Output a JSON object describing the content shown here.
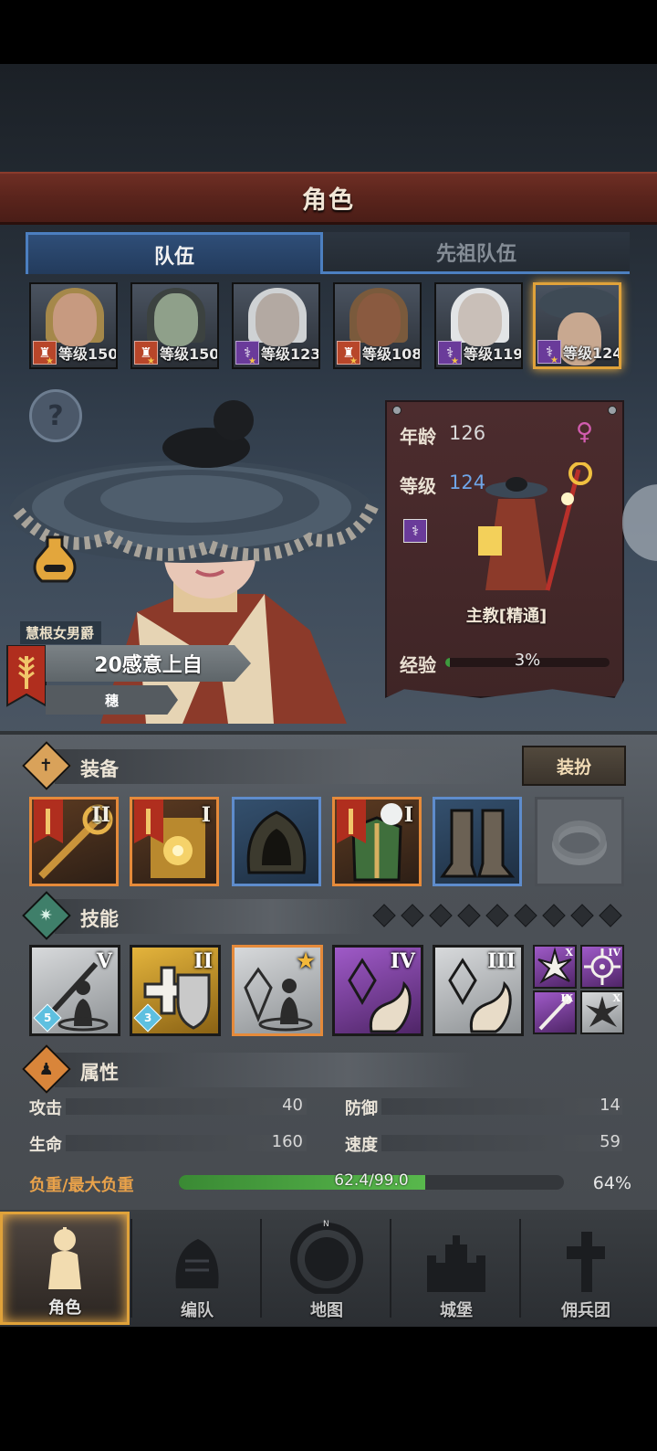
{
  "header": {
    "title": "角色"
  },
  "tabs": [
    {
      "label": "队伍",
      "active": true
    },
    {
      "label": "先祖队伍",
      "active": false
    }
  ],
  "roster": [
    {
      "level_text": "等级150",
      "class_color": "red",
      "class_icon": "warrior-class-icon"
    },
    {
      "level_text": "等级150",
      "class_color": "red",
      "class_icon": "warrior-class-icon"
    },
    {
      "level_text": "等级123",
      "class_color": "purple",
      "class_icon": "staff-class-icon"
    },
    {
      "level_text": "等级108",
      "class_color": "red",
      "class_icon": "warrior-class-icon"
    },
    {
      "level_text": "等级119",
      "class_color": "purple",
      "class_icon": "staff-class-icon"
    },
    {
      "level_text": "等级124",
      "class_color": "purple",
      "class_icon": "staff-class-icon",
      "selected": true
    }
  ],
  "character": {
    "name_tag": "慧根女男爵",
    "title": "20感意上自",
    "subtitle": "穗",
    "age_label": "年龄",
    "age": "126",
    "level_label": "等级",
    "level": "124",
    "gender_icon": "female-icon",
    "class_name": "主教[精通]",
    "exp_label": "经验",
    "exp_text": "3%",
    "exp_fraction": 0.03
  },
  "equipment": {
    "title": "装备",
    "outfit_button": "装扮",
    "slots": [
      {
        "tier": "II",
        "rarity": "orange",
        "has_flag": true,
        "icon": "weapon-icon"
      },
      {
        "tier": "I",
        "rarity": "orange",
        "has_flag": true,
        "icon": "book-icon"
      },
      {
        "tier": "",
        "rarity": "blue",
        "has_flag": false,
        "icon": "hood-icon"
      },
      {
        "tier": "I",
        "rarity": "orange",
        "has_flag": true,
        "icon": "armor-icon"
      },
      {
        "tier": "",
        "rarity": "blue",
        "has_flag": false,
        "icon": "boots-icon"
      },
      {
        "tier": "",
        "rarity": "empty",
        "has_flag": false,
        "icon": "ring-icon"
      }
    ]
  },
  "skills": {
    "title": "技能",
    "pips": 9,
    "items": [
      {
        "tier": "V",
        "color": "grey",
        "gem": "5",
        "icon": "spear-skill-icon"
      },
      {
        "tier": "II",
        "color": "gold",
        "gem": "3",
        "icon": "shield-heal-skill-icon"
      },
      {
        "tier": "★",
        "color": "grey",
        "gem": "",
        "icon": "crystal-skill-icon",
        "highlight": true
      },
      {
        "tier": "IV",
        "color": "purple",
        "gem": "",
        "icon": "crystal-hand-skill-icon"
      },
      {
        "tier": "III",
        "color": "grey",
        "gem": "",
        "icon": "crystal-hand-skill-icon"
      }
    ],
    "mini": [
      {
        "tier": "X",
        "color": "purple",
        "icon": "burst-icon"
      },
      {
        "tier": "IV",
        "color": "purple",
        "icon": "target-icon"
      },
      {
        "tier": "IX",
        "color": "purple",
        "icon": "staff-icon"
      },
      {
        "tier": "X",
        "color": "grey",
        "icon": "burst-icon"
      }
    ]
  },
  "attributes": {
    "title": "属性",
    "attack_label": "攻击",
    "attack": "40",
    "defense_label": "防御",
    "defense": "14",
    "hp_label": "生命",
    "hp": "160",
    "speed_label": "速度",
    "speed": "59",
    "load_label": "负重/最大负重",
    "load_text": "62.4/99.0",
    "load_pct": "64%",
    "load_fraction": 0.64
  },
  "nav": [
    {
      "label": "角色",
      "active": true,
      "icon": "knight-icon"
    },
    {
      "label": "编队",
      "active": false,
      "icon": "helmet-icon"
    },
    {
      "label": "地图",
      "active": false,
      "icon": "compass-icon"
    },
    {
      "label": "城堡",
      "active": false,
      "icon": "castle-icon"
    },
    {
      "label": "佣兵团",
      "active": false,
      "icon": "mercenary-icon"
    }
  ],
  "colors": {
    "accent_gold": "#e0a23a",
    "banner_red": "#5a241c",
    "tab_blue": "#4c7fc0",
    "level_blue": "#6fa5e8",
    "load_green": "#58b84c"
  }
}
